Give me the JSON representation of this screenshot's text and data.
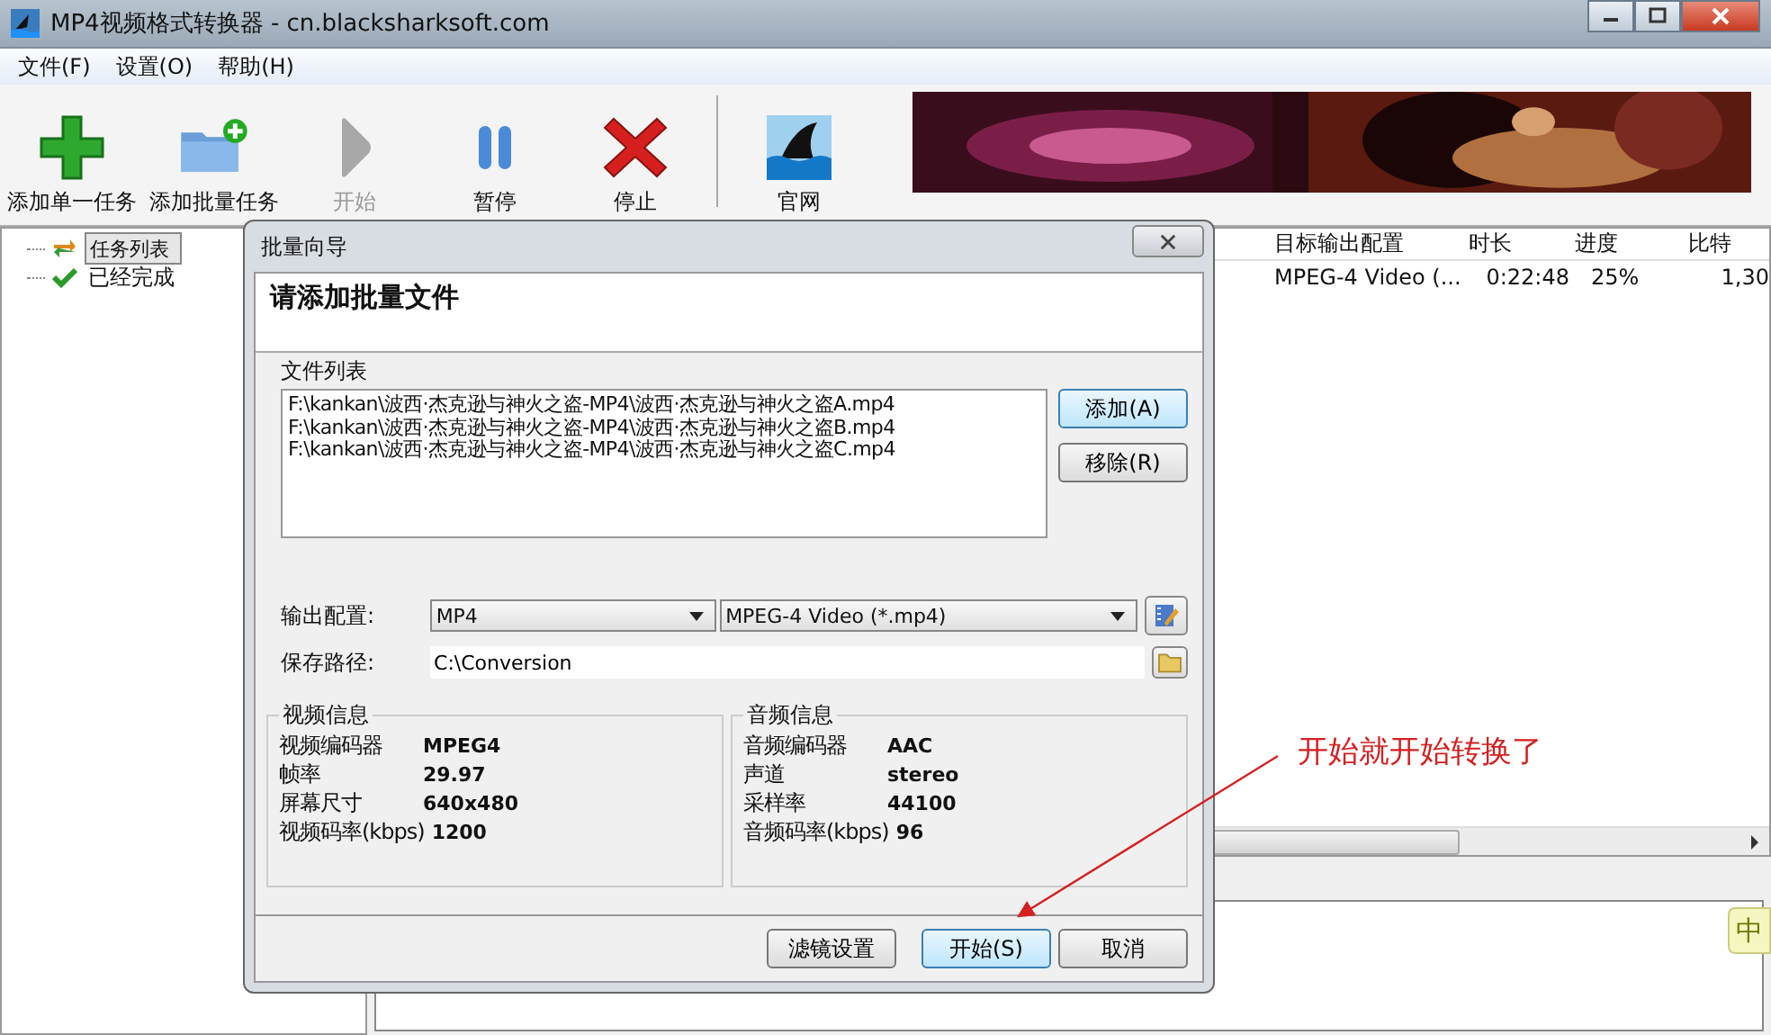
{
  "window": {
    "title": "MP4视频格式转换器 - cn.blacksharksoft.com"
  },
  "menu": [
    "文件(F)",
    "设置(O)",
    "帮助(H)"
  ],
  "toolbar": [
    {
      "label": "添加单一任务",
      "kind": "add",
      "disabled": false
    },
    {
      "label": "添加批量任务",
      "kind": "folder",
      "disabled": false
    },
    {
      "label": "开始",
      "kind": "play",
      "disabled": true
    },
    {
      "label": "暂停",
      "kind": "pause",
      "disabled": false
    },
    {
      "label": "停止",
      "kind": "stop",
      "disabled": false
    },
    {
      "label": "官网",
      "kind": "web",
      "disabled": false
    }
  ],
  "banner": {
    "kind": "picture"
  },
  "tree": [
    {
      "label": "任务列表",
      "kind": "tasks",
      "selected": true
    },
    {
      "label": "已经完成",
      "kind": "done",
      "selected": false
    }
  ],
  "table": {
    "columns": [
      "目标输出配置",
      "时长",
      "进度",
      "比特"
    ],
    "rows": [
      [
        "MPEG-4 Video (...",
        "0:22:48",
        "25%",
        "1,30"
      ]
    ]
  },
  "dialog": {
    "title": "批量向导",
    "heading": "请添加批量文件",
    "files_label": "文件列表",
    "files": [
      "F:\\kankan\\波西·杰克逊与神火之盗-MP4\\波西·杰克逊与神火之盗A.mp4",
      "F:\\kankan\\波西·杰克逊与神火之盗-MP4\\波西·杰克逊与神火之盗B.mp4",
      "F:\\kankan\\波西·杰克逊与神火之盗-MP4\\波西·杰克逊与神火之盗C.mp4"
    ],
    "side_buttons": [
      "添加(A)",
      "移除(R)"
    ],
    "output_label": "输出配置:",
    "format": "MP4",
    "profile": "MPEG-4 Video (*.mp4)",
    "path_label": "保存路径:",
    "path": "C:\\Conversion",
    "video": {
      "title": "视频信息",
      "rows": [
        [
          "视频编码器",
          "MPEG4"
        ],
        [
          "帧率",
          "29.97"
        ],
        [
          "屏幕尺寸",
          "640x480"
        ],
        [
          "视频码率(kbps)",
          "1200"
        ]
      ]
    },
    "audio": {
      "title": "音频信息",
      "rows": [
        [
          "音频编码器",
          "AAC"
        ],
        [
          "声道",
          "stereo"
        ],
        [
          "采样率",
          "44100"
        ],
        [
          "音频码率(kbps)",
          "96"
        ]
      ]
    },
    "buttons": [
      {
        "label": "滤镜设置",
        "default": false
      },
      {
        "label": "开始(S)",
        "default": true
      },
      {
        "label": "取消",
        "default": false
      }
    ]
  },
  "annotation": "开始就开始转换了",
  "ime": "中"
}
